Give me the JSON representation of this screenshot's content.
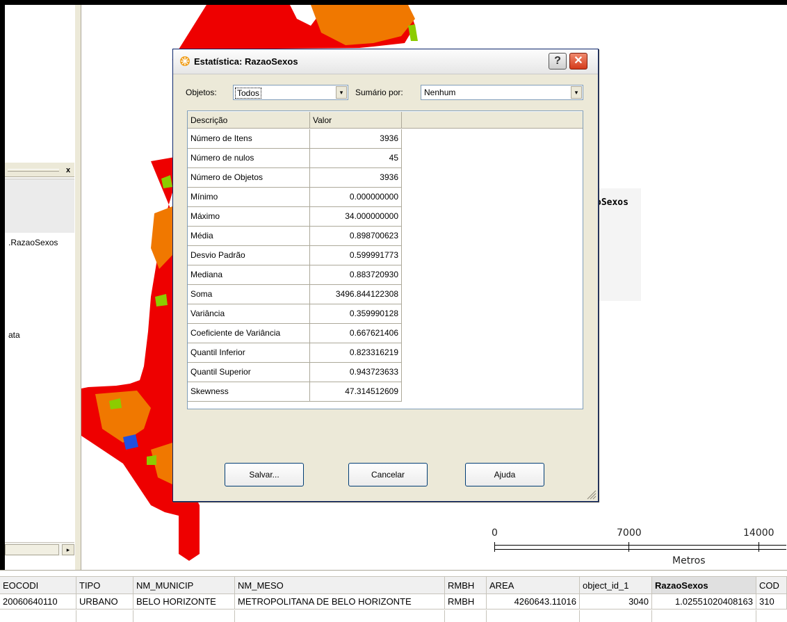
{
  "left_panel": {
    "close_glyph": "x",
    "layer_label": ".RazaoSexos",
    "item_label": "ata",
    "hscroll_arrow": "▸"
  },
  "map": {
    "legend_title": "oSexos",
    "scale": {
      "labels": [
        "0",
        "7000",
        "14000"
      ],
      "unit": "Metros"
    },
    "colors": {
      "red": "#ee0000",
      "orange": "#f07800",
      "green": "#8ccc00",
      "blue": "#2050e0"
    }
  },
  "dialog": {
    "title": "Estatística: RazaoSexos",
    "help_glyph": "?",
    "close_glyph": "✕",
    "objetos_label": "Objetos:",
    "objetos_value": "Todos",
    "sumario_label": "Sumário por:",
    "sumario_value": "Nenhum",
    "dropdown_glyph": "▾",
    "table_headers": [
      "Descrição",
      "Valor"
    ],
    "stats": [
      {
        "desc": "Número de Itens",
        "value": "3936"
      },
      {
        "desc": "Número de nulos",
        "value": "45"
      },
      {
        "desc": "Número de Objetos",
        "value": "3936"
      },
      {
        "desc": "Mínimo",
        "value": "0.000000000"
      },
      {
        "desc": "Máximo",
        "value": "34.000000000"
      },
      {
        "desc": "Média",
        "value": "0.898700623"
      },
      {
        "desc": "Desvio Padrão",
        "value": "0.599991773"
      },
      {
        "desc": "Mediana",
        "value": "0.883720930"
      },
      {
        "desc": "Soma",
        "value": "3496.844122308"
      },
      {
        "desc": "Variância",
        "value": "0.359990128"
      },
      {
        "desc": "Coeficiente de Variância",
        "value": "0.667621406"
      },
      {
        "desc": "Quantil Inferior",
        "value": "0.823316219"
      },
      {
        "desc": "Quantil Superior",
        "value": "0.943723633"
      },
      {
        "desc": "Skewness",
        "value": "47.314512609"
      }
    ],
    "buttons": {
      "save_label": "Salvar...",
      "cancel_label": "Cancelar",
      "help_label": "Ajuda"
    }
  },
  "attribute_table": {
    "headers": [
      "EOCODI",
      "TIPO",
      "NM_MUNICIP",
      "NM_MESO",
      "RMBH",
      "AREA",
      "object_id_1",
      "RazaoSexos",
      "COD"
    ],
    "row1": [
      "20060640110",
      "URBANO",
      "BELO HORIZONTE",
      "METROPOLITANA DE BELO HORIZONTE",
      "RMBH",
      "4260643.11016",
      "3040",
      "1.02551020408163",
      "310"
    ]
  }
}
